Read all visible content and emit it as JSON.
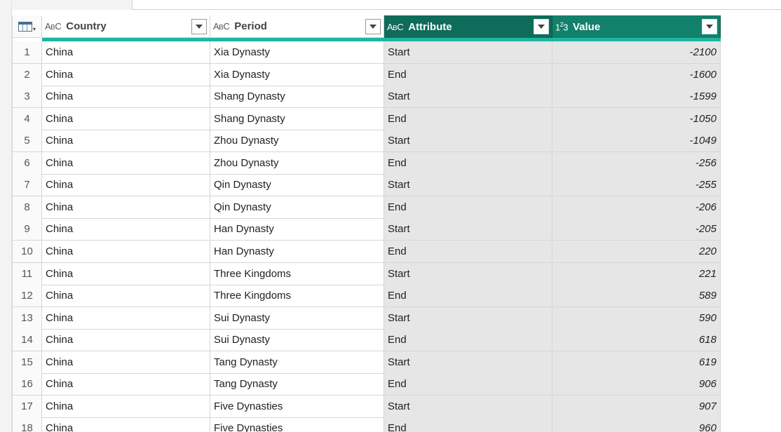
{
  "columns": [
    {
      "name": "Country",
      "type_icon": "ABC",
      "selected": false
    },
    {
      "name": "Period",
      "type_icon": "ABC",
      "selected": false
    },
    {
      "name": "Attribute",
      "type_icon": "ABC",
      "selected": true
    },
    {
      "name": "Value",
      "type_icon": "123",
      "selected": true
    }
  ],
  "icons": {
    "table_menu": "table-icon",
    "text_type": "abc-type-icon",
    "number_type": "123-type-icon",
    "dropdown": "chevron-down-icon"
  },
  "colors": {
    "selected_header": "#0f6b5a",
    "quality_bar": "#1fb5a3",
    "selected_column_bg": "#e6e6e6"
  },
  "rows": [
    {
      "num": "1",
      "country": "China",
      "period": "Xia Dynasty",
      "attribute": "Start",
      "value": "-2100"
    },
    {
      "num": "2",
      "country": "China",
      "period": "Xia Dynasty",
      "attribute": "End",
      "value": "-1600"
    },
    {
      "num": "3",
      "country": "China",
      "period": "Shang Dynasty",
      "attribute": "Start",
      "value": "-1599"
    },
    {
      "num": "4",
      "country": "China",
      "period": "Shang Dynasty",
      "attribute": "End",
      "value": "-1050"
    },
    {
      "num": "5",
      "country": "China",
      "period": "Zhou Dynasty",
      "attribute": "Start",
      "value": "-1049"
    },
    {
      "num": "6",
      "country": "China",
      "period": "Zhou Dynasty",
      "attribute": "End",
      "value": "-256"
    },
    {
      "num": "7",
      "country": "China",
      "period": "Qin Dynasty",
      "attribute": "Start",
      "value": "-255"
    },
    {
      "num": "8",
      "country": "China",
      "period": "Qin Dynasty",
      "attribute": "End",
      "value": "-206"
    },
    {
      "num": "9",
      "country": "China",
      "period": "Han Dynasty",
      "attribute": "Start",
      "value": "-205"
    },
    {
      "num": "10",
      "country": "China",
      "period": "Han Dynasty",
      "attribute": "End",
      "value": "220"
    },
    {
      "num": "11",
      "country": "China",
      "period": "Three Kingdoms",
      "attribute": "Start",
      "value": "221"
    },
    {
      "num": "12",
      "country": "China",
      "period": "Three Kingdoms",
      "attribute": "End",
      "value": "589"
    },
    {
      "num": "13",
      "country": "China",
      "period": "Sui Dynasty",
      "attribute": "Start",
      "value": "590"
    },
    {
      "num": "14",
      "country": "China",
      "period": "Sui Dynasty",
      "attribute": "End",
      "value": "618"
    },
    {
      "num": "15",
      "country": "China",
      "period": "Tang Dynasty",
      "attribute": "Start",
      "value": "619"
    },
    {
      "num": "16",
      "country": "China",
      "period": "Tang Dynasty",
      "attribute": "End",
      "value": "906"
    },
    {
      "num": "17",
      "country": "China",
      "period": "Five Dynasties",
      "attribute": "Start",
      "value": "907"
    },
    {
      "num": "18",
      "country": "China",
      "period": "Five Dynasties",
      "attribute": "End",
      "value": "960"
    }
  ]
}
